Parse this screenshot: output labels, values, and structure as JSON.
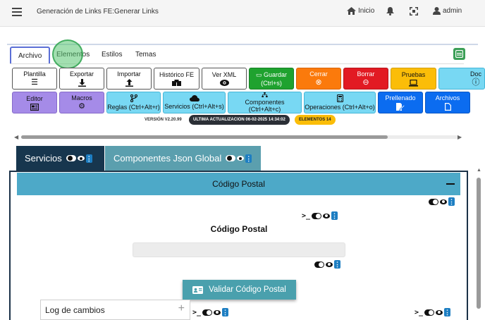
{
  "topbar": {
    "title": "Generación de Links FE:Generar Links",
    "nav_home": "Inicio",
    "nav_user": "admin"
  },
  "editor_tabs": [
    "Archivo",
    "Elementos",
    "Estilos",
    "Temas"
  ],
  "toolbar_row1": [
    {
      "label": "Plantilla",
      "icon": "menu-icon"
    },
    {
      "label": "Exportar",
      "icon": "download-icon"
    },
    {
      "label": "Importar",
      "icon": "upload-icon"
    },
    {
      "label": "Histórico FE",
      "icon": "boxes-icon"
    },
    {
      "label": "Ver XML",
      "icon": "eye-icon"
    },
    {
      "label": "Guardar",
      "sublabel": "(Ctrl+s)",
      "icon": "save-icon"
    },
    {
      "label": "Cerrar",
      "icon": "close-circle-icon"
    },
    {
      "label": "Borrar",
      "icon": "minus-circle-icon"
    },
    {
      "label": "Pruebas",
      "icon": "laptop-icon"
    },
    {
      "label": "Doc",
      "icon": "question-icon"
    }
  ],
  "toolbar_row2": [
    {
      "label": "Editor",
      "icon": "newspaper-icon"
    },
    {
      "label": "Macros",
      "icon": "gears-icon"
    },
    {
      "label": "Reglas (Ctrl+Alt+r)",
      "icon": "branch-icon"
    },
    {
      "label": "Servicios (Ctrl+Alt+s)",
      "icon": "cloud-icon"
    },
    {
      "label": "Componentes (Ctrl+Alt+c)",
      "icon": "sitemap-icon"
    },
    {
      "label": "Operaciones (Ctrl+Alt+o)",
      "icon": "calculator-icon"
    },
    {
      "label": "Prellenado",
      "icon": "form-icon"
    },
    {
      "label": "Archivos",
      "icon": "file-icon"
    }
  ],
  "status": {
    "version": "VERSIÓN V2.20.99",
    "last_update": "ULTIMA ACTUALIZACION 06-02-2025 14:34:02",
    "elements": "ELEMENTOS 14"
  },
  "content_tabs": {
    "servicios": "Servicios",
    "componentes": "Componentes Json Global"
  },
  "panel": {
    "header": "Código Postal",
    "field_label": "Código Postal",
    "validate_button": "Validar Código Postal",
    "log_label": "Log de cambios",
    "terminal_glyph": ">_",
    "more_glyph": "⋮"
  },
  "colors": {
    "nav_dark": "#17364e",
    "teal": "#5b9fae",
    "panel_header": "#4da9c8",
    "highlight": "#56c470"
  }
}
